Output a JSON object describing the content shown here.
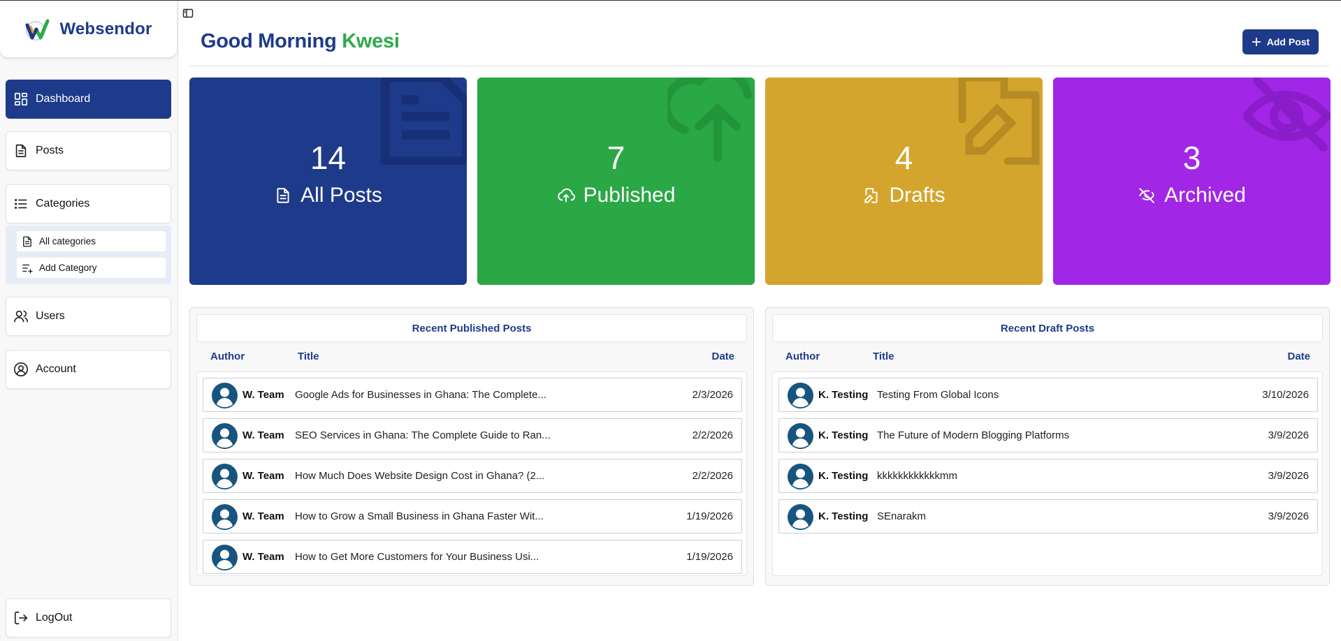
{
  "brand": {
    "name": "Websendor"
  },
  "sidebar": {
    "items": [
      {
        "label": "Dashboard"
      },
      {
        "label": "Posts"
      },
      {
        "label": "Categories"
      },
      {
        "label": "Users"
      },
      {
        "label": "Account"
      },
      {
        "label": "LogOut"
      }
    ],
    "categories_sub": [
      {
        "label": "All categories"
      },
      {
        "label": "Add Category"
      }
    ]
  },
  "header": {
    "greeting": "Good Morning",
    "user_name": "Kwesi",
    "add_post_label": "Add Post"
  },
  "stats": [
    {
      "count": "14",
      "label": "All Posts",
      "color": "#1e3a8a",
      "icon": "document-icon"
    },
    {
      "count": "7",
      "label": "Published",
      "color": "#2aa845",
      "icon": "cloud-upload-icon"
    },
    {
      "count": "4",
      "label": "Drafts",
      "color": "#d4a52d",
      "icon": "file-pen-icon"
    },
    {
      "count": "3",
      "label": "Archived",
      "color": "#a126e6",
      "icon": "eye-off-icon"
    }
  ],
  "published": {
    "title": "Recent Published Posts",
    "columns": {
      "author": "Author",
      "title": "Title",
      "date": "Date"
    },
    "rows": [
      {
        "author": "W. Team",
        "title": "Google Ads for Businesses in Ghana: The Complete...",
        "date": "2/3/2026"
      },
      {
        "author": "W. Team",
        "title": "SEO Services in Ghana: The Complete Guide to Ran...",
        "date": "2/2/2026"
      },
      {
        "author": "W. Team",
        "title": "How Much Does Website Design Cost in Ghana? (2...",
        "date": "2/2/2026"
      },
      {
        "author": "W. Team",
        "title": "How to Grow a Small Business in Ghana Faster Wit...",
        "date": "1/19/2026"
      },
      {
        "author": "W. Team",
        "title": "How to Get More Customers for Your Business Usi...",
        "date": "1/19/2026"
      }
    ]
  },
  "drafts": {
    "title": "Recent Draft Posts",
    "columns": {
      "author": "Author",
      "title": "Title",
      "date": "Date"
    },
    "rows": [
      {
        "author": "K. Testing",
        "title": "Testing From Global Icons",
        "date": "3/10/2026"
      },
      {
        "author": "K. Testing",
        "title": "The Future of Modern Blogging Platforms",
        "date": "3/9/2026"
      },
      {
        "author": "K. Testing",
        "title": "kkkkkkkkkkkkmm",
        "date": "3/9/2026"
      },
      {
        "author": "K. Testing",
        "title": "SEnarakm",
        "date": "3/9/2026"
      }
    ]
  },
  "colors": {
    "brand_blue": "#1e3a8a",
    "greeting_green": "#2eaa4a"
  }
}
